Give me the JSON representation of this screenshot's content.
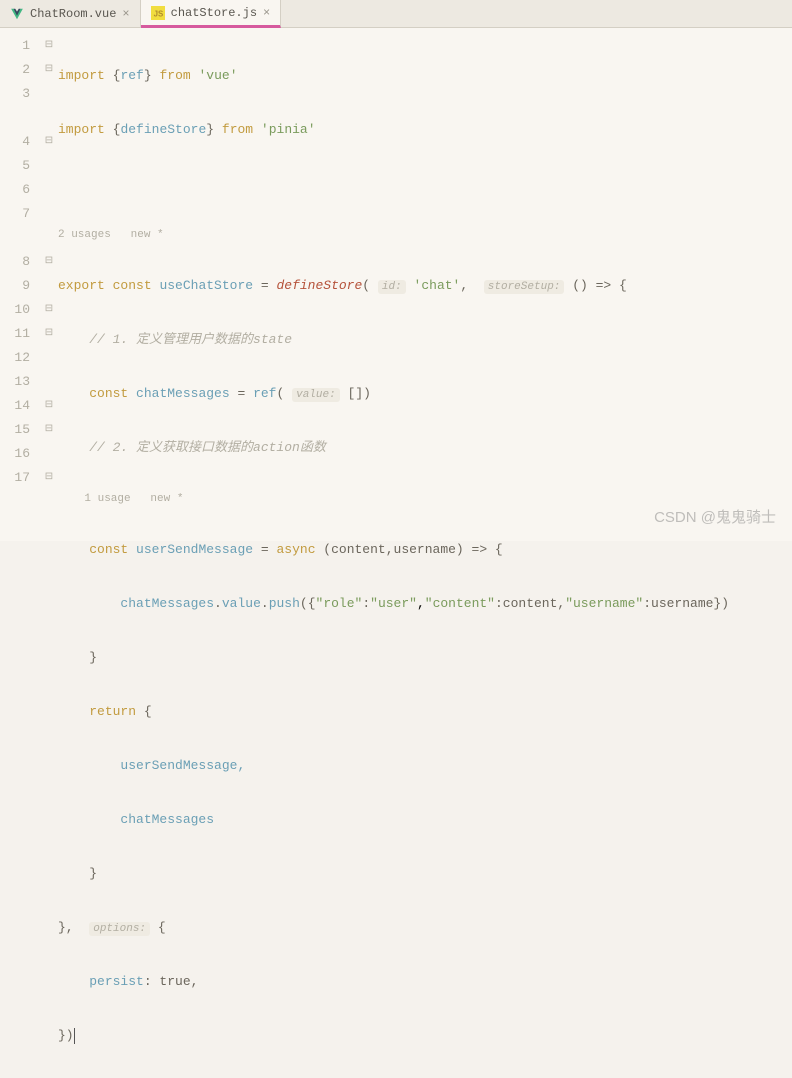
{
  "tabs": [
    {
      "icon": "vue-icon",
      "label": "ChatRoom.vue",
      "active": false
    },
    {
      "icon": "js-icon",
      "label": "chatStore.js",
      "active": true
    }
  ],
  "gutter": [
    "1",
    "2",
    "3",
    "",
    "4",
    "5",
    "6",
    "7",
    "",
    "8",
    "9",
    "10",
    "11",
    "12",
    "13",
    "14",
    "15",
    "16",
    "17"
  ],
  "fold": [
    "⊟",
    "⊟",
    "",
    "",
    "⊟",
    "",
    "",
    "",
    "",
    "⊟",
    "",
    "⊟",
    "⊟",
    "",
    "",
    "⊟",
    "⊟",
    "",
    "⊟"
  ],
  "code": {
    "l1": {
      "kw": "import",
      "b1": "{",
      "fn": "ref",
      "b2": "}",
      "from": "from",
      "str": "'vue'"
    },
    "l2": {
      "kw": "import",
      "b1": "{",
      "fn": "defineStore",
      "b2": "}",
      "from": "from",
      "str": "'pinia'"
    },
    "usages1": "2 usages   new *",
    "l4": {
      "kw1": "export const",
      "fn": "useChatStore",
      "eq": " = ",
      "def": "defineStore",
      "lp": "(",
      "hint1": "id:",
      "str": "'chat'",
      "comma": ", ",
      "hint2": "storeSetup:",
      "arrow": " () => {"
    },
    "l5": "// 1. 定义管理用户数据的state",
    "l6": {
      "kw": "const",
      "var": "chatMessages",
      "eq": " = ",
      "fn": "ref",
      "lp": "(",
      "hint": "value:",
      "arr": " [])"
    },
    "l7": "// 2. 定义获取接口数据的action函数",
    "usages2": "1 usage   new *",
    "l8": {
      "kw": "const",
      "var": "userSendMessage",
      "eq": " = ",
      "async": "async",
      "params": " (content,username) => {"
    },
    "l9": {
      "obj": "chatMessages",
      "dot1": ".",
      "p1": "value",
      "dot2": ".",
      "p2": "push",
      "args": "({",
      "k1": "\"role\"",
      "c1": ":",
      "v1": "\"user\"",
      "k2": "\"content\"",
      "c2": ":content,",
      "k3": "\"username\"",
      "c3": ":username})"
    },
    "l10": "}",
    "l11": {
      "kw": "return",
      "b": " {"
    },
    "l12": "userSendMessage,",
    "l13": "chatMessages",
    "l14": "}",
    "l15": {
      "b": "}, ",
      "hint": "options:",
      "b2": " {"
    },
    "l16": {
      "k": "persist",
      "v": ": true,"
    },
    "l17": "})"
  },
  "watermark": "CSDN @鬼鬼骑士"
}
